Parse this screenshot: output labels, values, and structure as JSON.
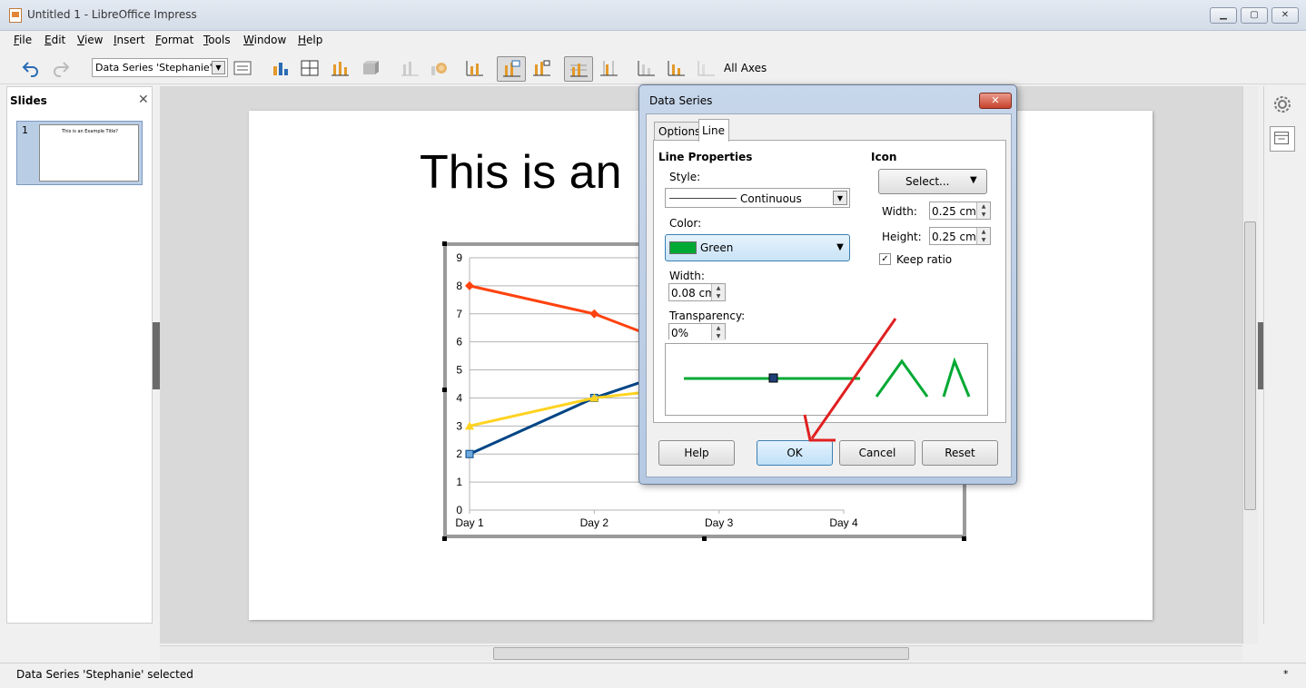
{
  "window": {
    "title": "Untitled 1 - LibreOffice Impress",
    "controls": {
      "minimize": "▁",
      "maximize": "▢",
      "close": "✕"
    }
  },
  "menu": [
    "File",
    "Edit",
    "View",
    "Insert",
    "Format",
    "Tools",
    "Window",
    "Help"
  ],
  "toolbar": {
    "series_select": "Data Series 'Stephanie'",
    "all_axes": "All Axes"
  },
  "slides_pane": {
    "title": "Slides",
    "close": "✕",
    "slide_number": "1",
    "thumb_title": "This is an Example Title?"
  },
  "slide": {
    "title": "This is an"
  },
  "chart_data": {
    "type": "line",
    "categories": [
      "Day 1",
      "Day 2",
      "Day 3",
      "Day 4"
    ],
    "ylim": [
      0,
      9
    ],
    "yticks": [
      "0",
      "1",
      "2",
      "3",
      "4",
      "5",
      "6",
      "7",
      "8",
      "9"
    ],
    "grid": true,
    "series": [
      {
        "color": "#ff420e",
        "marker": "diamond",
        "values": [
          8,
          7,
          5.3,
          null
        ]
      },
      {
        "color": "#004586",
        "marker": "square",
        "values": [
          2,
          4,
          5.5,
          null
        ]
      },
      {
        "color": "#ffd320",
        "marker": "triangle",
        "values": [
          3,
          4,
          4.5,
          null
        ]
      }
    ]
  },
  "dialog": {
    "title": "Data Series",
    "close": "✕",
    "tabs": [
      "Options",
      "Line"
    ],
    "active_tab": "Line",
    "line_properties": {
      "heading": "Line Properties",
      "style_label": "Style:",
      "style_value": "Continuous",
      "color_label": "Color:",
      "color_value": "Green",
      "color_hex": "#00a933",
      "width_label": "Width:",
      "width_value": "0.08 cm",
      "transparency_label": "Transparency:",
      "transparency_value": "0%"
    },
    "icon": {
      "heading": "Icon",
      "select_label": "Select...",
      "width_label": "Width:",
      "width_value": "0.25 cm",
      "height_label": "Height:",
      "height_value": "0.25 cm",
      "keep_ratio_label": "Keep ratio",
      "keep_ratio_checked": "✓"
    },
    "buttons": {
      "help": "Help",
      "ok": "OK",
      "cancel": "Cancel",
      "reset": "Reset"
    }
  },
  "statusbar": {
    "text": "Data Series 'Stephanie' selected",
    "star": "*"
  },
  "colors": {
    "accent_blue": "#3c7fb1",
    "annotation_red": "#e02020"
  }
}
